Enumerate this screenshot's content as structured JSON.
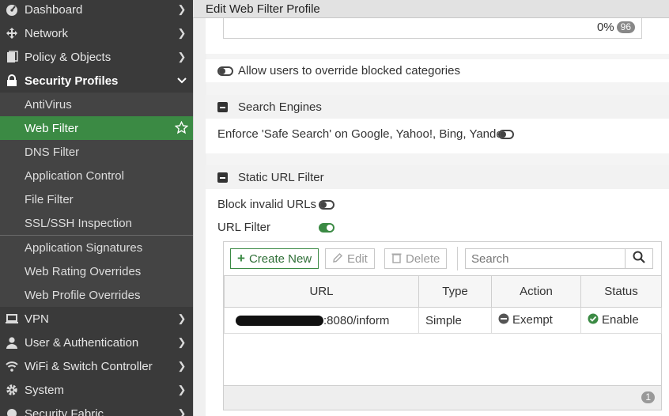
{
  "sidebar": {
    "top_items": [
      {
        "label": "Dashboard",
        "icon": "dashboard-icon"
      },
      {
        "label": "Network",
        "icon": "network-icon"
      },
      {
        "label": "Policy & Objects",
        "icon": "policy-icon"
      },
      {
        "label": "Security Profiles",
        "icon": "lock-icon"
      }
    ],
    "security_sub": [
      "AntiVirus",
      "Web Filter",
      "DNS Filter",
      "Application Control",
      "File Filter",
      "SSL/SSH Inspection"
    ],
    "security_sub2": [
      "Application Signatures",
      "Web Rating Overrides",
      "Web Profile Overrides"
    ],
    "bottom_items": [
      {
        "label": "VPN",
        "icon": "monitor-icon"
      },
      {
        "label": "User & Authentication",
        "icon": "user-icon"
      },
      {
        "label": "WiFi & Switch Controller",
        "icon": "wifi-icon"
      },
      {
        "label": "System",
        "icon": "gear-icon"
      },
      {
        "label": "Security Fabric",
        "icon": "fabric-icon"
      }
    ]
  },
  "title": "Edit Web Filter Profile",
  "top_box": {
    "percent": "0%",
    "count": "96"
  },
  "override": {
    "label": "Allow users to override blocked categories",
    "enabled": false
  },
  "search_engines": {
    "header": "Search Engines",
    "safe_search_label": "Enforce 'Safe Search' on Google, Yahoo!, Bing, Yandex",
    "enabled": false
  },
  "static_url": {
    "header": "Static URL Filter",
    "block_invalid_label": "Block invalid URLs",
    "url_filter_label": "URL Filter",
    "buttons": {
      "create": "Create New",
      "edit": "Edit",
      "delete": "Delete"
    },
    "search_placeholder": "Search",
    "columns": [
      "URL",
      "Type",
      "Action",
      "Status"
    ],
    "rows": [
      {
        "url": ":8080/inform",
        "type": "Simple",
        "action": "Exempt",
        "status": "Enable"
      }
    ],
    "footer_count": "1"
  },
  "colors": {
    "accent": "#3b8a44",
    "sidebar": "#3a3a3a"
  }
}
